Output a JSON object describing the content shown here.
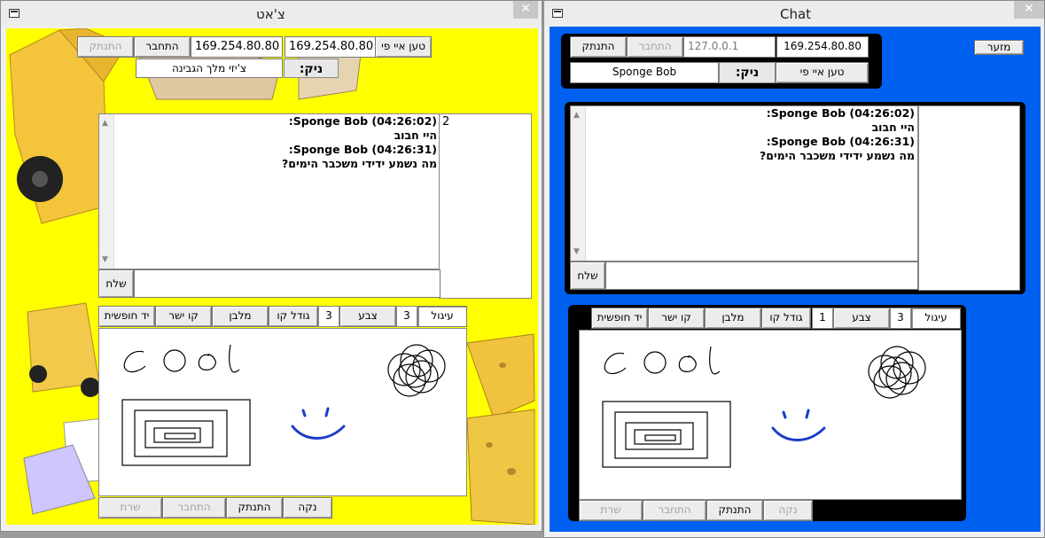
{
  "left": {
    "title": "צ'אט",
    "close": "✕",
    "disconnect": "התנתק",
    "connect": "התחבר",
    "ip1": "169.254.80.80",
    "ip2": "169.254.80.80",
    "load_ip": "טען איי פי",
    "nick_value": "צ'יזי מלך הגבינה",
    "nick_label": "ניק:",
    "chat": [
      "Sponge Bob (04:26:02):",
      "היי חבוב",
      "Sponge Bob (04:26:31):",
      "מה נשמע ידידי משכבר הימים?"
    ],
    "users_count": "2",
    "send": "שלח",
    "tools": {
      "circle": "עיגול",
      "circle_num": "3",
      "color": "צבע",
      "color_num": "3",
      "line_size": "גודל קו",
      "rect": "מלבן",
      "line": "קו ישר",
      "freehand": "יד חופשית"
    },
    "bottom": {
      "clear": "נקה",
      "disconnect": "התנתק",
      "connect": "התחבר",
      "server": "שרת"
    },
    "drawing_text": "cool"
  },
  "right": {
    "title": "Chat",
    "close": "✕",
    "disconnect": "התנתק",
    "connect": "התחבר",
    "ip_local": "127.0.0.1",
    "ip": "169.254.80.80",
    "minimize": "מזער",
    "nick_value": "Sponge Bob",
    "nick_label": "ניק:",
    "load_ip": "טען איי פי",
    "chat": [
      "Sponge Bob (04:26:02):",
      "היי חבוב",
      "Sponge Bob (04:26:31):",
      "מה נשמע ידידי משכבר הימים?"
    ],
    "send": "שלח",
    "tools": {
      "circle": "עיגול",
      "circle_num": "3",
      "color": "צבע",
      "color_num": "1",
      "line_size": "גודל קו",
      "rect": "מלבן",
      "line": "קו ישר",
      "freehand": "יד חופשית"
    },
    "bottom": {
      "clear": "נקה",
      "disconnect": "התנתק",
      "connect": "התחבר",
      "server": "שרת"
    },
    "drawing_text": "cool"
  },
  "colors": {
    "left_bg": "#ffff00",
    "right_bg": "#0060f0",
    "smiley": "#1a3cc8"
  }
}
